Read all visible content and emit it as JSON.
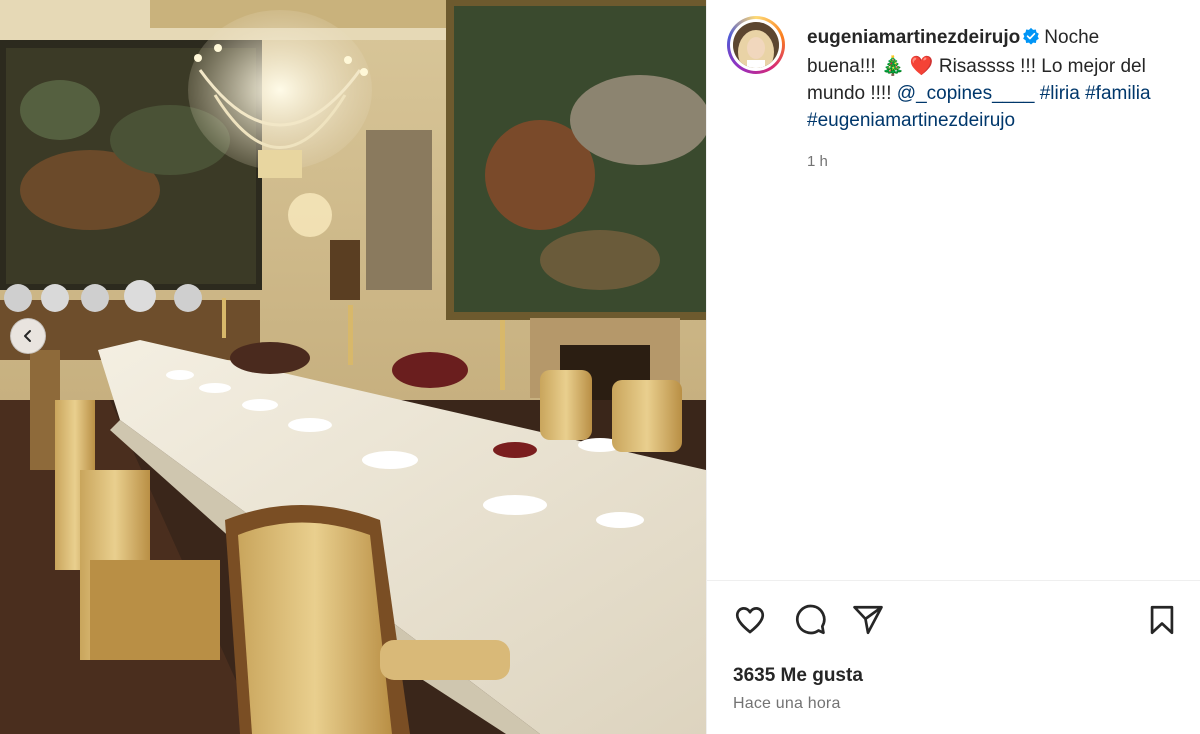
{
  "post": {
    "username": "eugeniamartinezdeirujo",
    "caption": {
      "text_1": "Noche buena!!! ",
      "emoji_tree": "🎄",
      "emoji_heart": "❤️",
      "text_2": " Risassss !!! Lo mejor del mundo !!!! ",
      "mention": "@_copines____",
      "hashtag_1": "#liria",
      "hashtag_2": "#familia",
      "hashtag_3": "#eugeniamartinezdeirujo"
    },
    "timestamp": "1 h"
  },
  "actions": {
    "likes": "3635 Me gusta",
    "time_ago": "Hace una hora",
    "like_icon": "heart-outline-icon",
    "comment_icon": "speech-bubble-icon",
    "share_icon": "paper-plane-icon",
    "save_icon": "bookmark-icon"
  },
  "colors": {
    "link": "#00376b",
    "verified": "#0095f6",
    "muted": "#737373"
  }
}
